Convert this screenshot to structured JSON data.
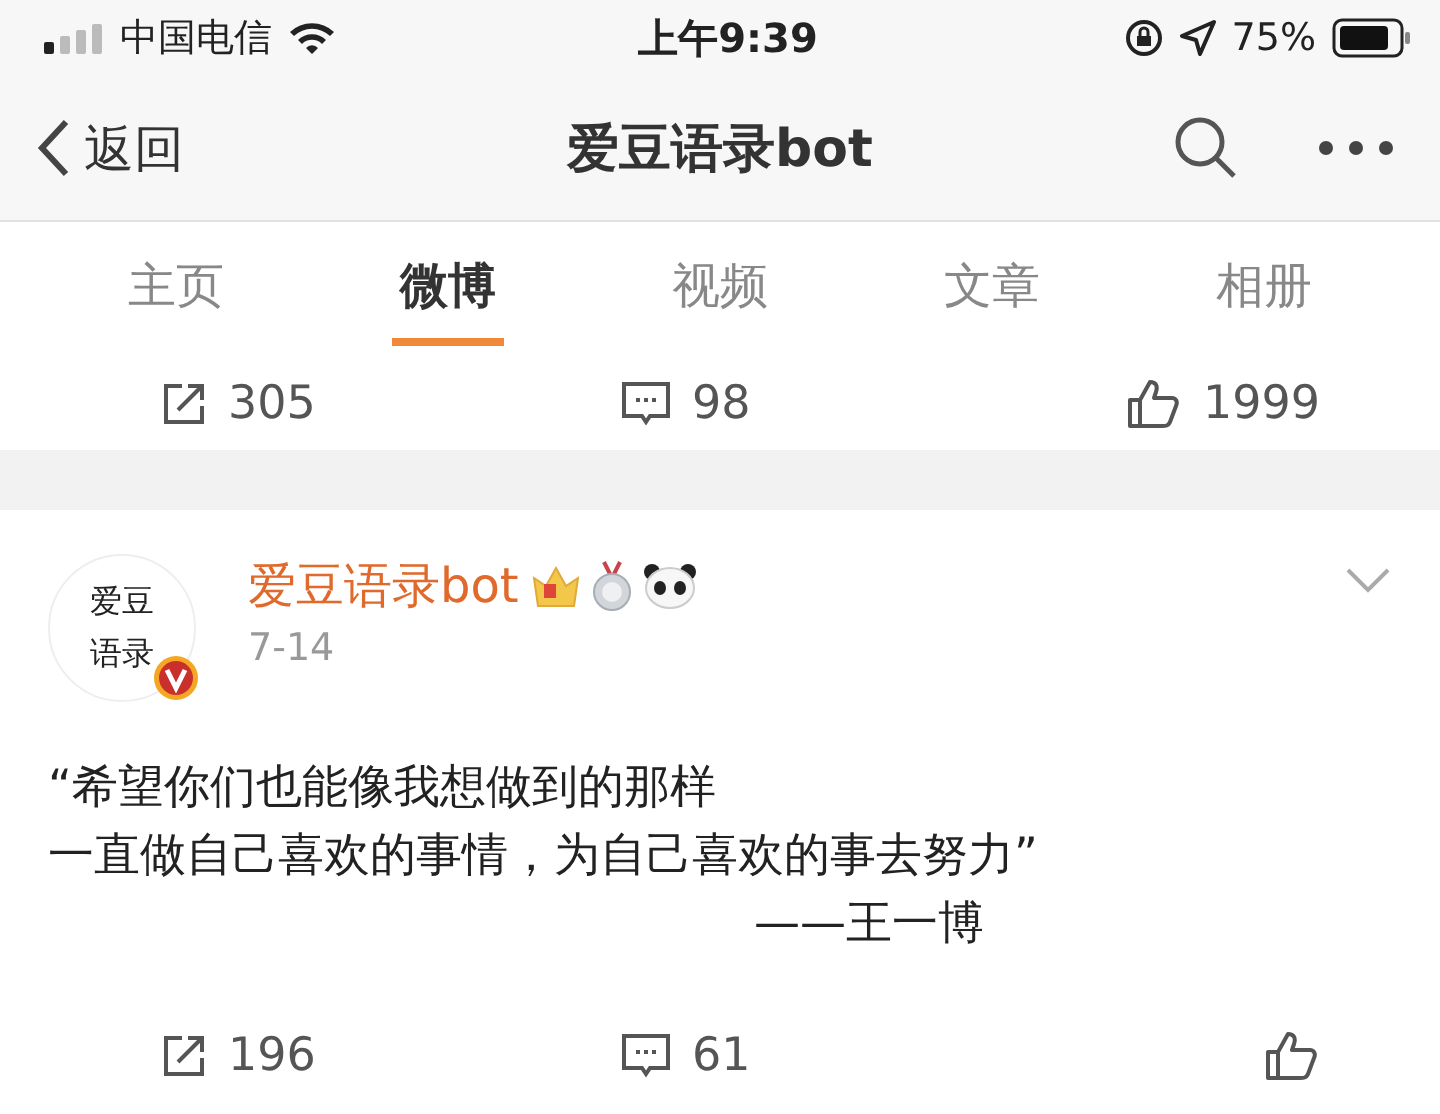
{
  "status_bar": {
    "carrier": "中国电信",
    "time": "上午9:39",
    "battery": "75%"
  },
  "nav": {
    "back": "返回",
    "title": "爱豆语录bot"
  },
  "tabs": [
    {
      "label": "主页",
      "selected": false
    },
    {
      "label": "微博",
      "selected": true
    },
    {
      "label": "视频",
      "selected": false
    },
    {
      "label": "文章",
      "selected": false
    },
    {
      "label": "相册",
      "selected": false
    }
  ],
  "previous_post_actions": [
    {
      "kind": "share",
      "count": "305"
    },
    {
      "kind": "comment",
      "count": "98"
    },
    {
      "kind": "like",
      "count": "1999"
    }
  ],
  "post": {
    "avatar_text": [
      "爱豆",
      "语录"
    ],
    "verified": true,
    "author": "爱豆语录bot",
    "date": "7-14",
    "lines": [
      "“希望你们也能像我想做到的那样",
      "一直做自己喜欢的事情，为自己喜欢的事去努力”"
    ],
    "signature": "——王一博",
    "actions": [
      {
        "kind": "share",
        "count": "196"
      },
      {
        "kind": "comment",
        "count": "61"
      },
      {
        "kind": "like"
      }
    ]
  }
}
